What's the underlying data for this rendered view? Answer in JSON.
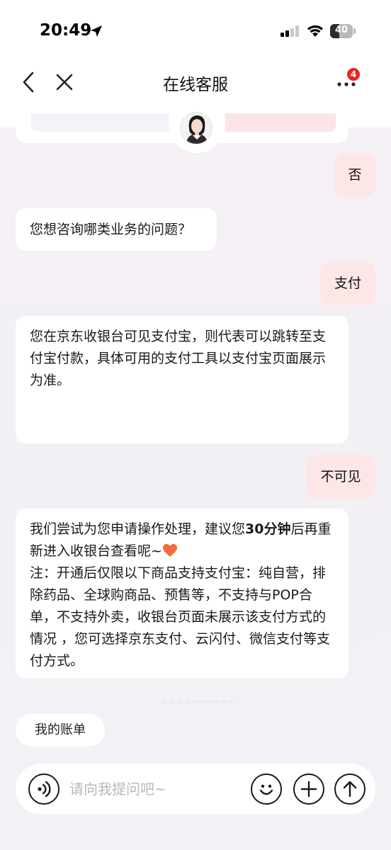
{
  "status_bar": {
    "time": "20:49",
    "battery_level": "40",
    "battery_fraction": 0.4
  },
  "nav": {
    "title": "在线客服",
    "badge_count": "4"
  },
  "messages": [
    {
      "role": "user",
      "text": "否"
    },
    {
      "role": "bot",
      "text": "您想咨询哪类业务的问题？"
    },
    {
      "role": "user",
      "text": "支付"
    },
    {
      "role": "bot",
      "text": "您在京东收银台可见支付宝，则代表可以跳转至支付宝付款，具体可用的支付工具以支付宝页面展示为准。"
    },
    {
      "role": "user",
      "text": "不可见"
    },
    {
      "role": "bot",
      "text_1": "我们尝试为您申请操作处理，建议您",
      "text_bold": "30分钟",
      "text_2": "后再重新进入收银台查看呢~",
      "text_3": "注：开通后仅限以下商品支持支付宝：纯自营，排除药品、全球购商品、预售等，不支持与POP合单，不支持外卖，收银台页面未展示该支付方式的情况 ，您可选择京东支付、云闪付、微信支付等支付方式。",
      "emoji": "heart-icon"
    }
  ],
  "quick_chips": [
    {
      "label": "我的账单"
    }
  ],
  "input": {
    "placeholder": "请向我提问吧~"
  },
  "colors": {
    "user_bubble": "#fde6e6",
    "bot_bubble": "#ffffff",
    "badge": "#e8261d",
    "heart": "#f46c3a"
  }
}
